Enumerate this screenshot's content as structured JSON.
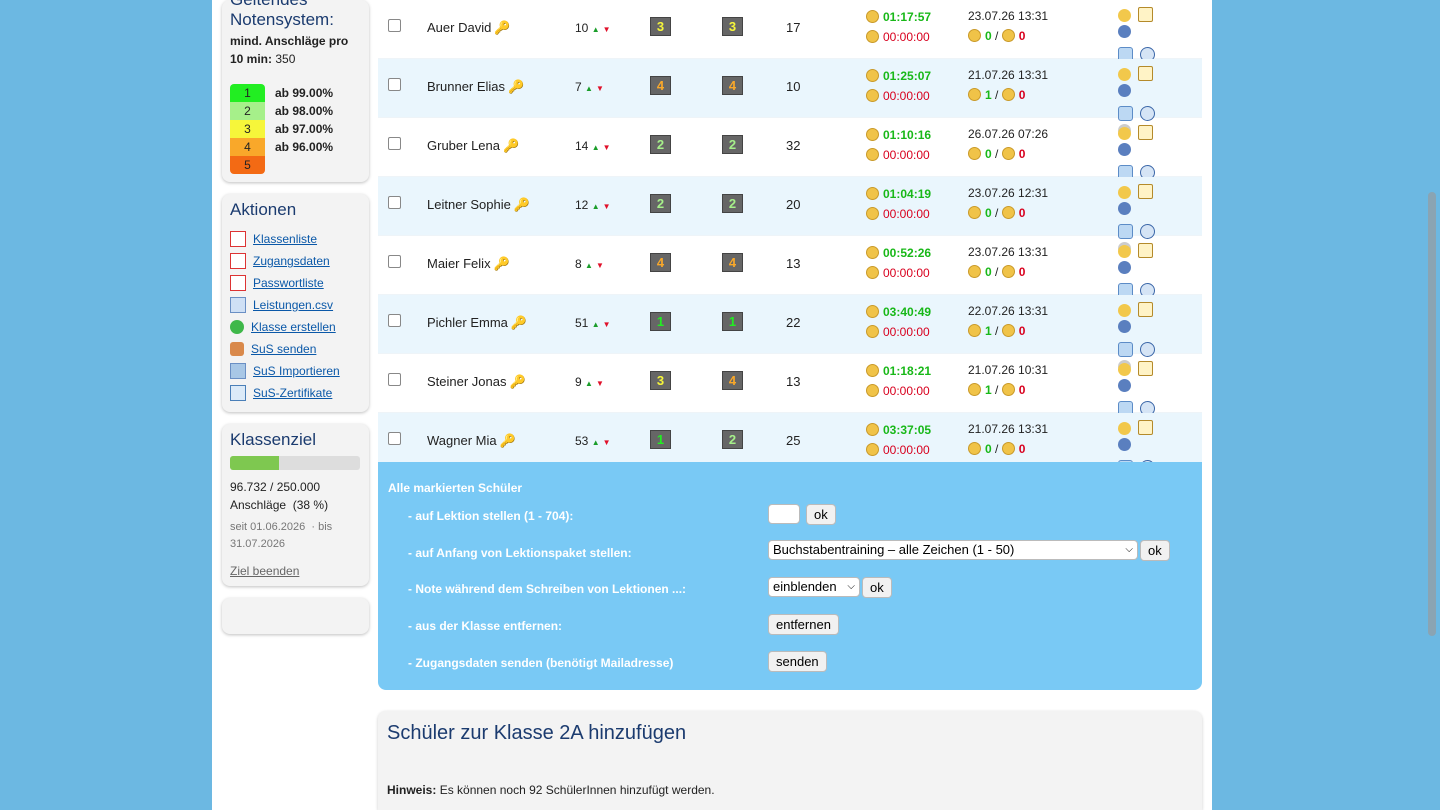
{
  "grading": {
    "title": "Geltendes Notensystem:",
    "min_label": "mind. Anschläge pro 10 min",
    "min_value": "350",
    "grades": [
      {
        "grade": "1",
        "threshold": "ab 99.00%",
        "color": "#22ee22"
      },
      {
        "grade": "2",
        "threshold": "ab 98.00%",
        "color": "#a6f08a"
      },
      {
        "grade": "3",
        "threshold": "ab 97.00%",
        "color": "#f6f63a"
      },
      {
        "grade": "4",
        "threshold": "ab 96.00%",
        "color": "#f9a82a"
      },
      {
        "grade": "5",
        "threshold": "",
        "color": "#f36a14"
      }
    ]
  },
  "actions": {
    "title": "Aktionen",
    "items": [
      {
        "label": "Klassenliste",
        "icon": "pdf-icon"
      },
      {
        "label": "Zugangsdaten",
        "icon": "pdf-icon"
      },
      {
        "label": "Passwortliste",
        "icon": "pdf-icon"
      },
      {
        "label": "Leistungen.csv",
        "icon": "csv-icon"
      },
      {
        "label": "Klasse erstellen",
        "icon": "add-icon"
      },
      {
        "label": "SuS senden",
        "icon": "users-send-icon"
      },
      {
        "label": "SuS Importieren",
        "icon": "import-icon"
      },
      {
        "label": "SuS-Zertifikate",
        "icon": "certificate-icon"
      }
    ]
  },
  "goal": {
    "title": "Klassenziel",
    "progress_fraction": 0.38,
    "count": "96.732 / 250.000",
    "unit": "Anschläge",
    "percent": "(38 %)",
    "since": "seit 01.06.2026",
    "until": "· bis 31.07.2026",
    "end_link": "Ziel beenden"
  },
  "students": [
    {
      "name": "Auer David",
      "lesson": "10",
      "grade1": "3",
      "grade2": "3",
      "count": "17",
      "time_green": "01:17:57",
      "time_red": "00:00:00",
      "date": "23.07.26 13:31",
      "ok": "0",
      "bad": "0"
    },
    {
      "name": "Brunner Elias",
      "lesson": "7",
      "grade1": "4",
      "grade2": "4",
      "count": "10",
      "time_green": "01:25:07",
      "time_red": "00:00:00",
      "date": "21.07.26 13:31",
      "ok": "1",
      "bad": "0"
    },
    {
      "name": "Gruber Lena",
      "lesson": "14",
      "grade1": "2",
      "grade2": "2",
      "count": "32",
      "time_green": "01:10:16",
      "time_red": "00:00:00",
      "date": "26.07.26 07:26",
      "ok": "0",
      "bad": "0"
    },
    {
      "name": "Leitner Sophie",
      "lesson": "12",
      "grade1": "2",
      "grade2": "2",
      "count": "20",
      "time_green": "01:04:19",
      "time_red": "00:00:00",
      "date": "23.07.26 12:31",
      "ok": "0",
      "bad": "0"
    },
    {
      "name": "Maier Felix",
      "lesson": "8",
      "grade1": "4",
      "grade2": "4",
      "count": "13",
      "time_green": "00:52:26",
      "time_red": "00:00:00",
      "date": "23.07.26 13:31",
      "ok": "0",
      "bad": "0"
    },
    {
      "name": "Pichler Emma",
      "lesson": "51",
      "grade1": "1",
      "grade2": "1",
      "count": "22",
      "time_green": "03:40:49",
      "time_red": "00:00:00",
      "date": "22.07.26 13:31",
      "ok": "1",
      "bad": "0"
    },
    {
      "name": "Steiner Jonas",
      "lesson": "9",
      "grade1": "3",
      "grade2": "4",
      "count": "13",
      "time_green": "01:18:21",
      "time_red": "00:00:00",
      "date": "21.07.26 10:31",
      "ok": "1",
      "bad": "0"
    },
    {
      "name": "Wagner Mia",
      "lesson": "53",
      "grade1": "1",
      "grade2": "2",
      "count": "25",
      "time_green": "03:37:05",
      "time_red": "00:00:00",
      "date": "21.07.26 13:31",
      "ok": "0",
      "bad": "0"
    }
  ],
  "bulk": {
    "title": "Alle markierten Schüler",
    "set_lesson": "- auf Lektion stellen (1 - 704):",
    "set_package": "- auf Anfang von Lektionspaket stellen:",
    "package_value": "Buchstabentraining – alle Zeichen (1 - 50)",
    "show_grade": "- Note während dem Schreiben von Lektionen ...:",
    "show_grade_value": "einblenden",
    "remove": "- aus der Klasse entfernen:",
    "remove_btn": "entfernen",
    "send": "- Zugangsdaten senden (benötigt Mailadresse)",
    "send_btn": "senden",
    "ok": "ok"
  },
  "add": {
    "title": "Schüler zur Klasse 2A hinzufügen",
    "hint_label": "Hinweis:",
    "hint_text": "Es können noch 92 SchülerInnen hinzufügt werden."
  },
  "colors": {
    "grade1": "#22ee22",
    "grade2": "#a6f08a",
    "grade3": "#f6f63a",
    "grade4": "#f9a82a"
  }
}
